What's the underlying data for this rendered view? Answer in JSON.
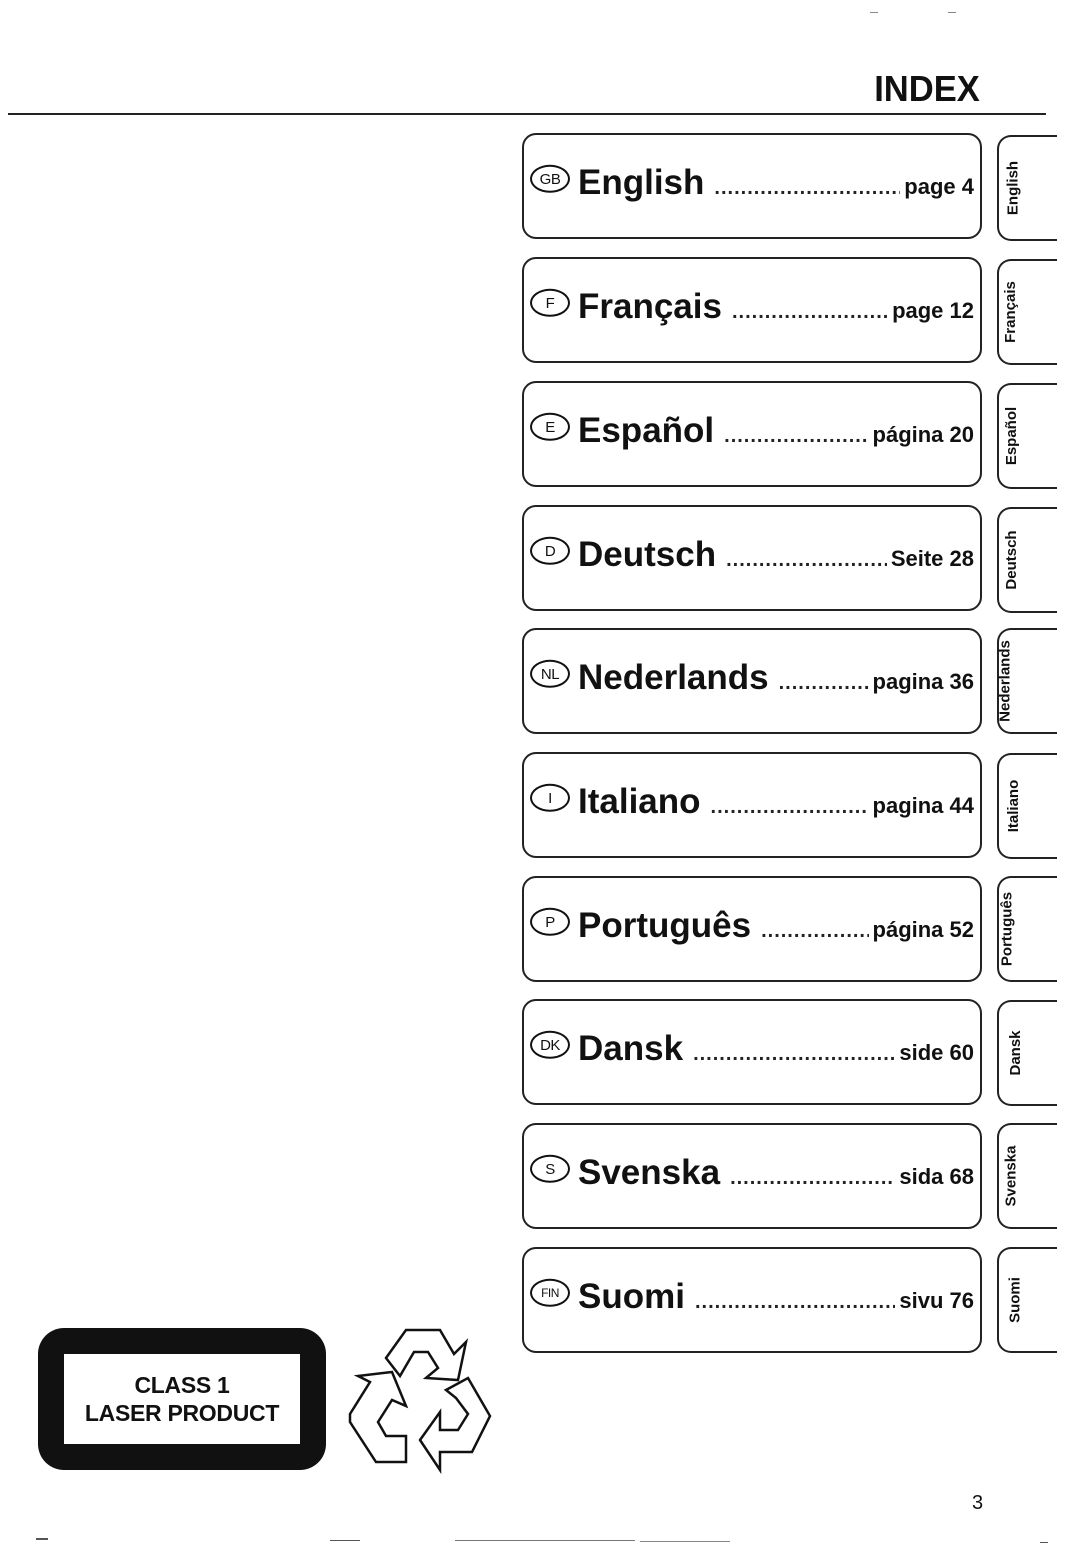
{
  "header": {
    "title": "INDEX"
  },
  "entries": [
    {
      "code": "GB",
      "language": "English",
      "page_ref": "page 4",
      "tab_label": "English"
    },
    {
      "code": "F",
      "language": "Français",
      "page_ref": "page 12",
      "tab_label": "Français"
    },
    {
      "code": "E",
      "language": "Español",
      "page_ref": "página 20",
      "tab_label": "Español"
    },
    {
      "code": "D",
      "language": "Deutsch",
      "page_ref": "Seite 28",
      "tab_label": "Deutsch"
    },
    {
      "code": "NL",
      "language": "Nederlands",
      "page_ref": "pagina 36",
      "tab_label": "Nederlands"
    },
    {
      "code": "I",
      "language": "Italiano",
      "page_ref": "pagina 44",
      "tab_label": "Italiano"
    },
    {
      "code": "P",
      "language": "Português",
      "page_ref": "página 52",
      "tab_label": "Português"
    },
    {
      "code": "DK",
      "language": "Dansk",
      "page_ref": "side 60",
      "tab_label": "Dansk"
    },
    {
      "code": "S",
      "language": "Svenska",
      "page_ref": "sida 68",
      "tab_label": "Svenska"
    },
    {
      "code": "FIN",
      "language": "Suomi",
      "page_ref": "sivu 76",
      "tab_label": "Suomi"
    }
  ],
  "laser_label": {
    "line1": "CLASS 1",
    "line2": "LASER PRODUCT"
  },
  "icons": {
    "recycle": "recycle-icon"
  },
  "footer": {
    "page_number": "3"
  },
  "colors": {
    "ink": "#111111",
    "paper": "#ffffff"
  }
}
